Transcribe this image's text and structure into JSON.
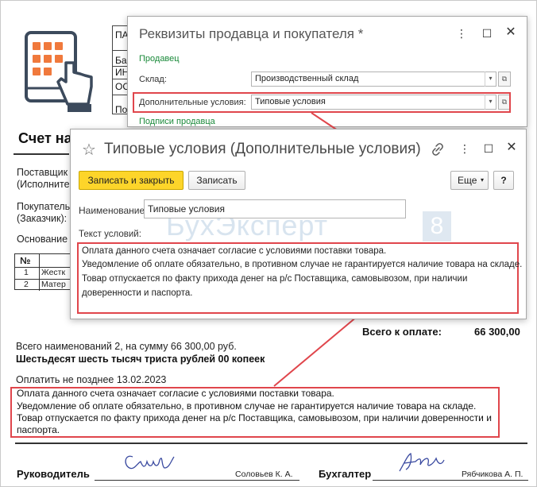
{
  "invoice": {
    "header_cells": [
      "ПА",
      "Ба",
      "ИН",
      "ОС",
      "По"
    ],
    "title": "Счет на",
    "supplier_label": [
      "Поставщик",
      "(Исполните"
    ],
    "buyer_label": [
      "Покупатель",
      "(Заказчик):"
    ],
    "basis_label": "Основание",
    "items_table": {
      "header": "№",
      "rows": [
        {
          "n": "1",
          "name": "Жестк"
        },
        {
          "n": "2",
          "name": "Матер"
        }
      ]
    },
    "total_label": "Всего к оплате:",
    "total_value": "66 300,00",
    "summary_line": "Всего наименований 2, на сумму 66 300,00 руб.",
    "amount_in_words": "Шестьдесят шесть тысяч триста рублей 00 копеек",
    "pay_by": "Оплатить не позднее 13.02.2023",
    "terms": [
      "Оплата данного счета означает согласие с условиями поставки товара.",
      "Уведомление об оплате обязательно, в противном случае не гарантируется наличие товара на складе.",
      "Товар отпускается по факту прихода денег на р/с Поставщика, самовывозом, при наличии доверенности и",
      "паспорта."
    ],
    "signatures": {
      "head_label": "Руководитель",
      "head_name": "Соловьев К. А.",
      "accountant_label": "Бухгалтер",
      "accountant_name": "Рябчикова А. П."
    }
  },
  "dialog_seller_buyer": {
    "title": "Реквизиты продавца и покупателя *",
    "section_seller": "Продавец",
    "warehouse_label": "Склад:",
    "warehouse_value": "Производственный склад",
    "extra_terms_label": "Дополнительные условия:",
    "extra_terms_value": "Типовые условия",
    "section_signatures": "Подписи продавца"
  },
  "dialog_terms": {
    "title": "Типовые условия (Дополнительные условия)",
    "save_close_label": "Записать и закрыть",
    "save_label": "Записать",
    "more_label": "Еще",
    "help_label": "?",
    "name_label": "Наименование:",
    "name_value": "Типовые условия",
    "terms_label": "Текст условий:",
    "terms_lines": [
      "Оплата данного счета означает согласие с условиями поставки товара.",
      "Уведомление об оплате обязательно, в противном случае не гарантируется наличие товара на складе.",
      "Товар отпускается по факту прихода денег на р/с Поставщика, самовывозом, при наличии",
      "доверенности и паспорта."
    ],
    "watermark": "БухЭксперт",
    "watermark_badge": "8"
  },
  "colors": {
    "highlight": "#e0464c",
    "section_green": "#1a8a3a",
    "primary_button": "#fdd52a",
    "logo_orange": "#f0793c"
  }
}
